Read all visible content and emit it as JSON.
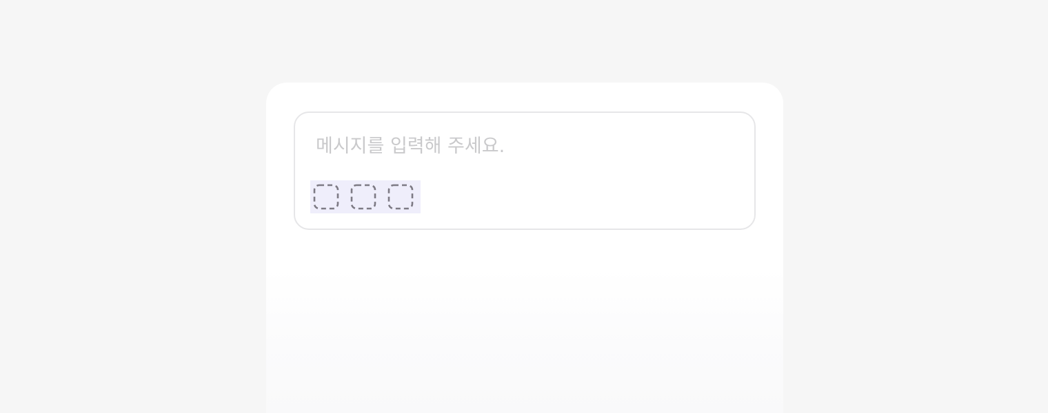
{
  "composer": {
    "placeholder": "메시지를 입력해 주세요.",
    "value": ""
  },
  "attachments": [
    {
      "icon": "dashed-square-icon"
    },
    {
      "icon": "dashed-square-icon"
    },
    {
      "icon": "dashed-square-icon"
    }
  ],
  "colors": {
    "page_background": "#f6f6f6",
    "panel_background": "#ffffff",
    "composer_border": "#e6e6e8",
    "placeholder_text": "#c9c9cb",
    "attachment_highlight": "#efeefb",
    "icon_stroke": "#7d7a84"
  }
}
